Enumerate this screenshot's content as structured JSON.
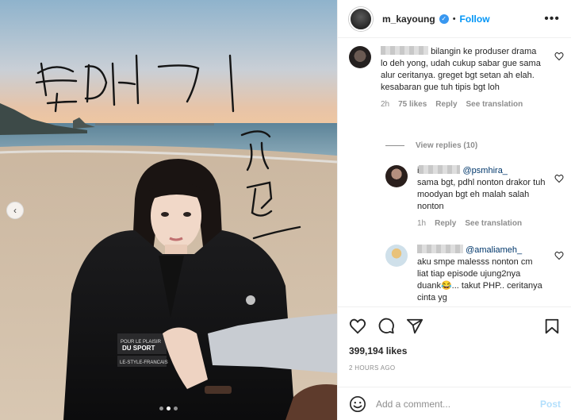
{
  "header": {
    "username": "m_kayoung",
    "separator": "•",
    "follow_label": "Follow",
    "more_label": "•••"
  },
  "comments": [
    {
      "text": "bilangin ke produser drama lo deh yong, udah cukup sabar gue sama alur ceritanya. greget bgt setan ah elah. kesabaran gue tuh tipis bgt loh",
      "time": "2h",
      "likes": "75 likes",
      "reply": "Reply",
      "translate": "See translation"
    }
  ],
  "view_replies": "View replies (10)",
  "replies": [
    {
      "prefix": "i",
      "mention": "@psmhira_",
      "text": "sama bgt, pdhl nonton drakor tuh moodyan bgt eh malah salah nonton",
      "time": "1h",
      "reply": "Reply",
      "translate": "See translation"
    },
    {
      "mention": "@amaliameh_",
      "text": "aku smpe malesss nonton cm liat tiap episode ujung2nya duank😂... takut PHP.. ceritanya cinta yg"
    }
  ],
  "post": {
    "likes": "399,194 likes",
    "time_ago": "2 HOURS AGO"
  },
  "add_comment": {
    "placeholder": "Add a comment...",
    "post_label": "Post"
  },
  "colors": {
    "accent": "#0095f6",
    "verified": "#3897f0",
    "post_disabled": "#b2dffc",
    "muted": "#8e8e8e"
  },
  "icons": [
    "heart-icon",
    "comment-icon",
    "share-icon",
    "save-icon",
    "emoji-icon",
    "verified-icon",
    "chevron-left-icon"
  ]
}
